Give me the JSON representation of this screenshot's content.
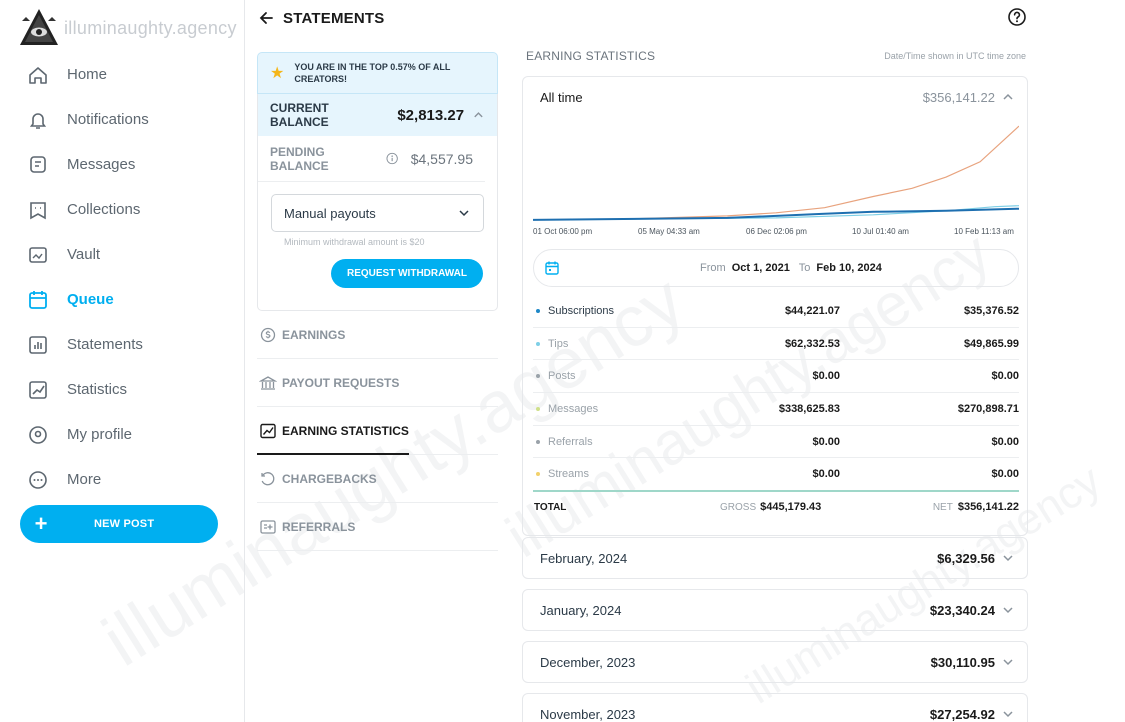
{
  "watermark": "illuminaughty.agency",
  "sidebar": {
    "items": [
      {
        "label": "Home",
        "icon": "home-icon"
      },
      {
        "label": "Notifications",
        "icon": "bell-icon"
      },
      {
        "label": "Messages",
        "icon": "message-icon"
      },
      {
        "label": "Collections",
        "icon": "collections-icon"
      },
      {
        "label": "Vault",
        "icon": "vault-icon"
      },
      {
        "label": "Queue",
        "icon": "calendar-icon",
        "active": true
      },
      {
        "label": "Statements",
        "icon": "statements-icon"
      },
      {
        "label": "Statistics",
        "icon": "statistics-icon"
      },
      {
        "label": "My profile",
        "icon": "profile-icon"
      },
      {
        "label": "More",
        "icon": "more-icon"
      }
    ],
    "new_post": "NEW POST"
  },
  "header": {
    "title": "STATEMENTS"
  },
  "banner": {
    "text": "YOU ARE IN THE TOP 0.57% OF ALL CREATORS!"
  },
  "balance": {
    "current_label": "CURRENT BALANCE",
    "current_value": "$2,813.27",
    "pending_label": "PENDING BALANCE",
    "pending_value": "$4,557.95",
    "payout_select": "Manual payouts",
    "min_note": "Minimum withdrawal amount is $20",
    "withdraw_button": "REQUEST WITHDRAWAL"
  },
  "menu": [
    {
      "label": "EARNINGS",
      "icon": "dollar-circle-icon"
    },
    {
      "label": "PAYOUT REQUESTS",
      "icon": "bank-icon"
    },
    {
      "label": "EARNING STATISTICS",
      "icon": "chart-icon",
      "active": true
    },
    {
      "label": "CHARGEBACKS",
      "icon": "undo-icon"
    },
    {
      "label": "REFERRALS",
      "icon": "referral-icon"
    }
  ],
  "stats": {
    "title": "EARNING STATISTICS",
    "timezone_note": "Date/Time shown in UTC time zone",
    "period_label": "All time",
    "period_total": "$356,141.22",
    "x_ticks": [
      "01 Oct 06:00 pm",
      "05 May 04:33 am",
      "06 Dec 02:06 pm",
      "10 Jul 01:40 am",
      "10 Feb 11:13 am"
    ],
    "date_range": {
      "from_label": "From",
      "from": "Oct 1, 2021",
      "to_label": "To",
      "to": "Feb 10, 2024"
    },
    "rows": [
      {
        "name": "Subscriptions",
        "gross": "$44,221.07",
        "net": "$35,376.52",
        "color": "#1e88c7"
      },
      {
        "name": "Tips",
        "gross": "$62,332.53",
        "net": "$49,865.99",
        "color": "#7ecfe6"
      },
      {
        "name": "Posts",
        "gross": "$0.00",
        "net": "$0.00",
        "color": "#9aa2a9"
      },
      {
        "name": "Messages",
        "gross": "$338,625.83",
        "net": "$270,898.71",
        "color": "#cfe08a"
      },
      {
        "name": "Referrals",
        "gross": "$0.00",
        "net": "$0.00",
        "color": "#9aa2a9"
      },
      {
        "name": "Streams",
        "gross": "$0.00",
        "net": "$0.00",
        "color": "#f2d16b"
      }
    ],
    "total": {
      "label": "TOTAL",
      "gross_label": "GROSS",
      "gross": "$445,179.43",
      "net_label": "NET",
      "net": "$356,141.22"
    }
  },
  "months": [
    {
      "label": "February, 2024",
      "value": "$6,329.56"
    },
    {
      "label": "January, 2024",
      "value": "$23,340.24"
    },
    {
      "label": "December, 2023",
      "value": "$30,110.95"
    },
    {
      "label": "November, 2023",
      "value": "$27,254.92"
    }
  ],
  "chart_colors": {
    "messages": "#e8a37e",
    "subscriptions": "#1e6fb0",
    "tips": "#7ecfe6",
    "accent": "#00aff0"
  }
}
